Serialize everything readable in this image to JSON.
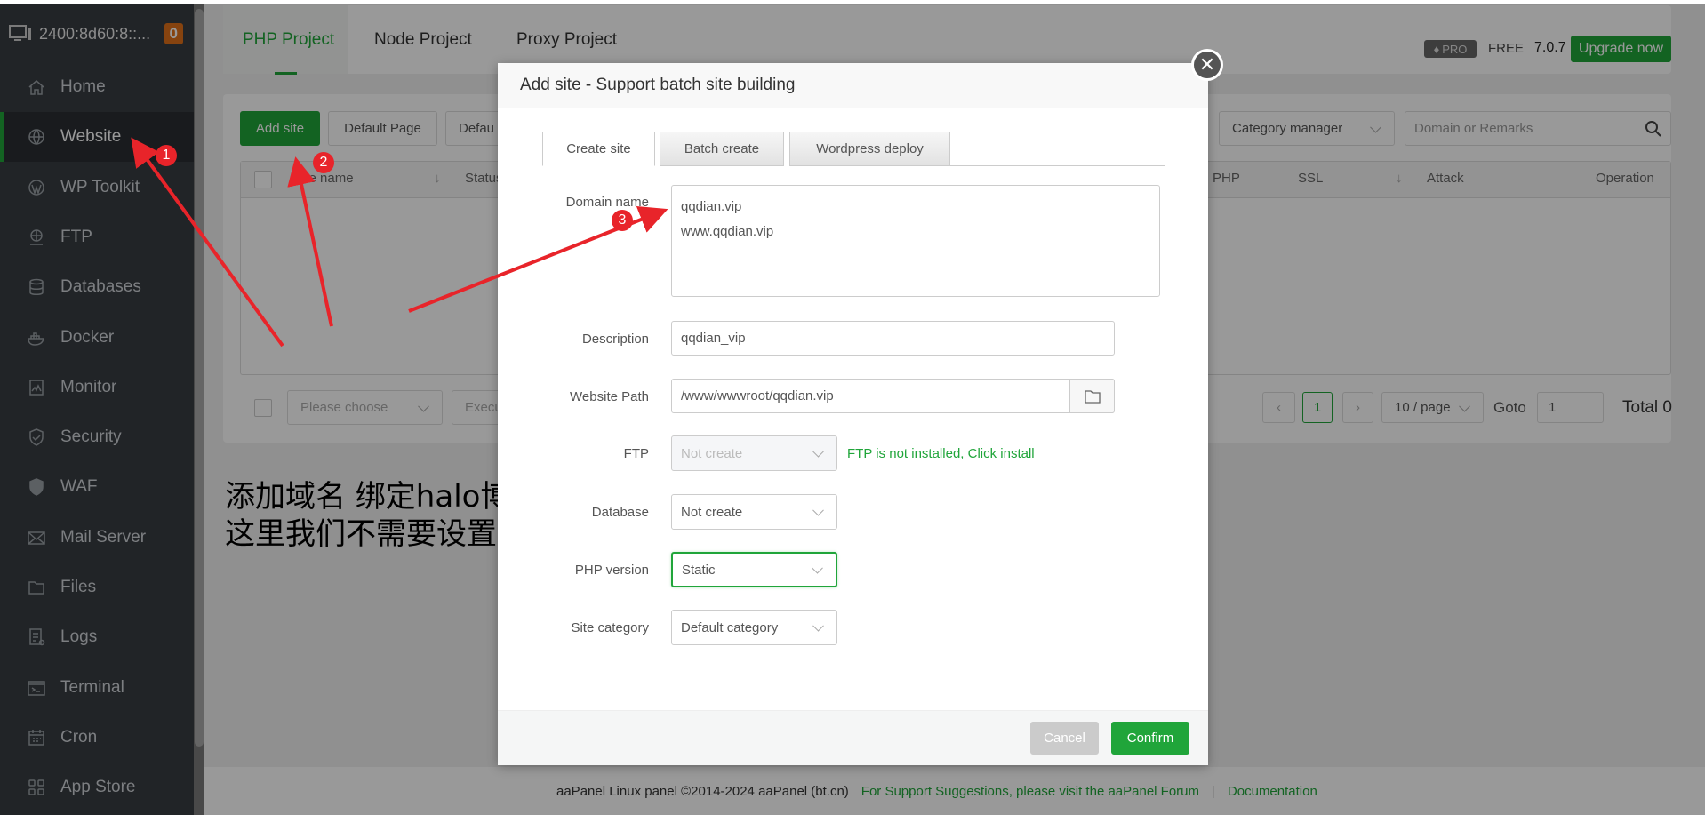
{
  "sidebar": {
    "server": "2400:8d60:8::...",
    "badge": "0",
    "items": [
      {
        "label": "Home",
        "icon": "home-icon"
      },
      {
        "label": "Website",
        "icon": "globe-icon"
      },
      {
        "label": "WP Toolkit",
        "icon": "wordpress-icon"
      },
      {
        "label": "FTP",
        "icon": "ftp-icon"
      },
      {
        "label": "Databases",
        "icon": "database-icon"
      },
      {
        "label": "Docker",
        "icon": "docker-icon"
      },
      {
        "label": "Monitor",
        "icon": "monitor-icon"
      },
      {
        "label": "Security",
        "icon": "shield-icon"
      },
      {
        "label": "WAF",
        "icon": "waf-shield-icon"
      },
      {
        "label": "Mail Server",
        "icon": "mail-icon"
      },
      {
        "label": "Files",
        "icon": "folder-icon"
      },
      {
        "label": "Logs",
        "icon": "logs-icon"
      },
      {
        "label": "Terminal",
        "icon": "terminal-icon"
      },
      {
        "label": "Cron",
        "icon": "calendar-icon"
      },
      {
        "label": "App Store",
        "icon": "grid-icon"
      }
    ],
    "active": "Website"
  },
  "tabs": [
    "PHP Project",
    "Node Project",
    "Proxy Project"
  ],
  "header": {
    "pro": "PRO",
    "free": "FREE",
    "version": "7.0.7",
    "upgrade": "Upgrade now"
  },
  "toolbar": {
    "add_site": "Add site",
    "default_page": "Default Page",
    "default_site": "Defau",
    "category": "Category manager",
    "search_placeholder": "Domain or Remarks"
  },
  "table": {
    "columns": [
      "Site name",
      "Status",
      "PHP",
      "SSL",
      "Attack",
      "Operation"
    ]
  },
  "bottom": {
    "choose": "Please choose",
    "execute": "Execu",
    "page": "1",
    "per_page": "10 / page",
    "goto": "Goto",
    "goto_value": "1",
    "total": "Total 0"
  },
  "footer": {
    "copyright": "aaPanel Linux panel ©2014-2024 aaPanel (bt.cn)",
    "support": "For Support Suggestions, please visit the aaPanel Forum",
    "docs": "Documentation"
  },
  "modal": {
    "title": "Add site - Support batch site building",
    "tabs": [
      "Create site",
      "Batch create",
      "Wordpress deploy"
    ],
    "domain_label": "Domain name",
    "domain_lines": [
      "qqdian.vip",
      "www.qqdian.vip"
    ],
    "desc_label": "Description",
    "desc_value": "qqdian_vip",
    "path_label": "Website Path",
    "path_value": "/www/wwwroot/qqdian.vip",
    "ftp_label": "FTP",
    "ftp_value": "Not create",
    "ftp_note": "FTP is not installed, Click install",
    "db_label": "Database",
    "db_value": "Not create",
    "php_label": "PHP version",
    "php_value": "Static",
    "cat_label": "Site category",
    "cat_value": "Default category",
    "cancel": "Cancel",
    "confirm": "Confirm"
  },
  "annotations": {
    "marks": [
      "1",
      "2",
      "3"
    ],
    "text": [
      "添加域名 绑定halo博客",
      "这里我们不需要设置数据库跟PHP"
    ],
    "color": "#e8242a"
  },
  "colors": {
    "accent": "#20a53a",
    "sidebar": "#373c42"
  }
}
